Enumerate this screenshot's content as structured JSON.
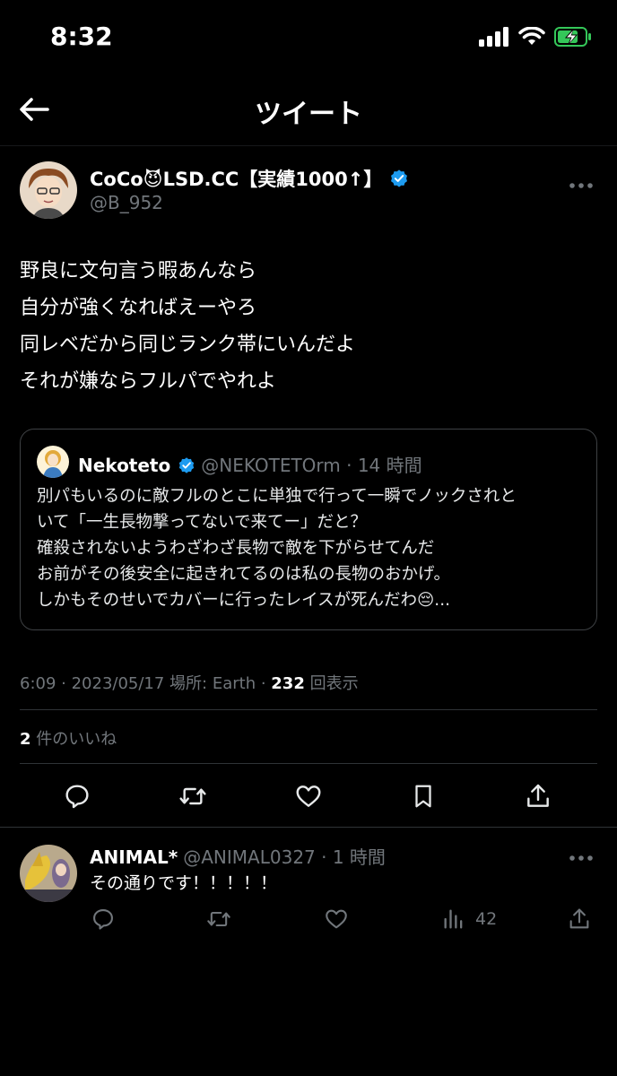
{
  "status_bar": {
    "time": "8:32"
  },
  "header": {
    "title": "ツイート"
  },
  "tweet": {
    "author_name": "CoCo😈LSD.CC【実績1000↑】",
    "author_handle": "@B_952",
    "text_lines": [
      "野良に文句言う暇あんなら",
      "自分が強くなればえーやろ",
      "同レベだから同じランク帯にいんだよ",
      "それが嫌ならフルパでやれよ"
    ],
    "quote": {
      "name": "Nekoteto",
      "meta": "@NEKOTETOrm · 14 時間",
      "lines": [
        "別パもいるのに敵フルのとこに単独で行って一瞬でノックされと",
        "いて「一生長物撃ってないで来てー」だと？",
        "確殺されないようわざわざ長物で敵を下がらせてんだ",
        "お前がその後安全に起きれてるのは私の長物のおかげ。",
        "しかもそのせいでカバーに行ったレイスが死んだわ😔..."
      ]
    },
    "meta_prefix": "6:09 · 2023/05/17 場所: Earth · ",
    "views_count": "232",
    "views_label": " 回表示",
    "likes_count": "2",
    "likes_label": " 件のいいね"
  },
  "reply": {
    "name": "ANIMAL*",
    "meta": "@ANIMAL0327 · 1 時間",
    "text": "その通りです！！！！！",
    "views": "42"
  },
  "colors": {
    "accent": "#1d9bf0",
    "muted": "#71767b",
    "border": "#2f3336",
    "battery": "#34c759"
  }
}
